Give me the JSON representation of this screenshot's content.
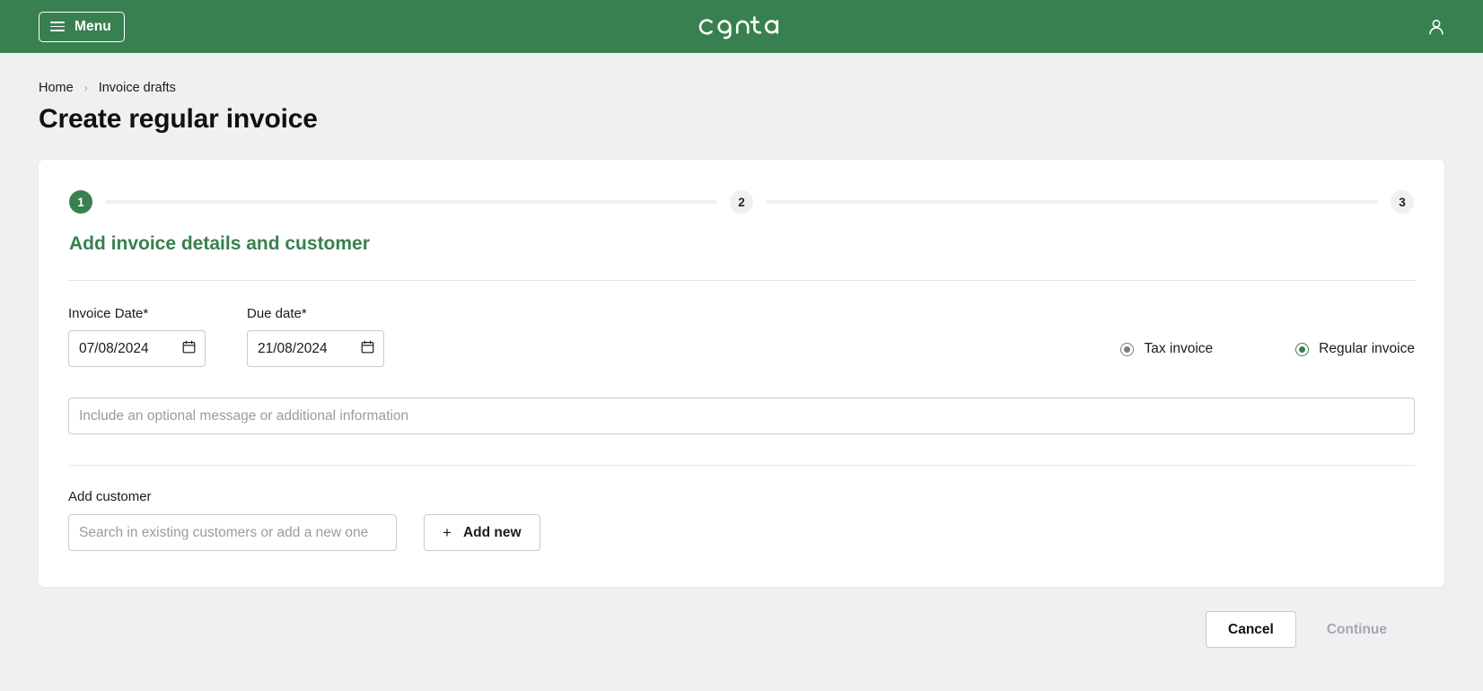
{
  "topbar": {
    "menu_label": "Menu",
    "logo_text": "conta",
    "brand_color": "#388050",
    "menu_icon": "hamburger-icon",
    "account_icon": "user-account-icon"
  },
  "breadcrumb": {
    "home": "Home",
    "separator": "›",
    "current": "Invoice drafts"
  },
  "page_title": "Create regular invoice",
  "stepper": {
    "steps": [
      {
        "number": "1",
        "state": "active"
      },
      {
        "number": "2",
        "state": "idle"
      },
      {
        "number": "3",
        "state": "idle"
      }
    ],
    "active_color": "#388050",
    "idle_color": "#f0f0f2",
    "heading": "Add invoice details and customer"
  },
  "form": {
    "invoice_date": {
      "label": "Invoice Date*",
      "value": "07/08/2024",
      "icon": "calendar-icon"
    },
    "due_date": {
      "label": "Due date*",
      "value": "21/08/2024",
      "icon": "calendar-icon"
    },
    "invoice_type": {
      "options": [
        {
          "label": "Tax invoice",
          "selected": false
        },
        {
          "label": "Regular invoice",
          "selected": true
        }
      ]
    },
    "message": {
      "placeholder": "Include an optional message or additional information",
      "value": ""
    },
    "customer": {
      "label": "Add customer",
      "search_placeholder": "Search in existing customers or add a new one",
      "search_value": "",
      "add_new_label": "Add new",
      "add_new_icon": "plus-icon"
    }
  },
  "footer": {
    "cancel_label": "Cancel",
    "continue_label": "Continue",
    "continue_disabled": true
  }
}
